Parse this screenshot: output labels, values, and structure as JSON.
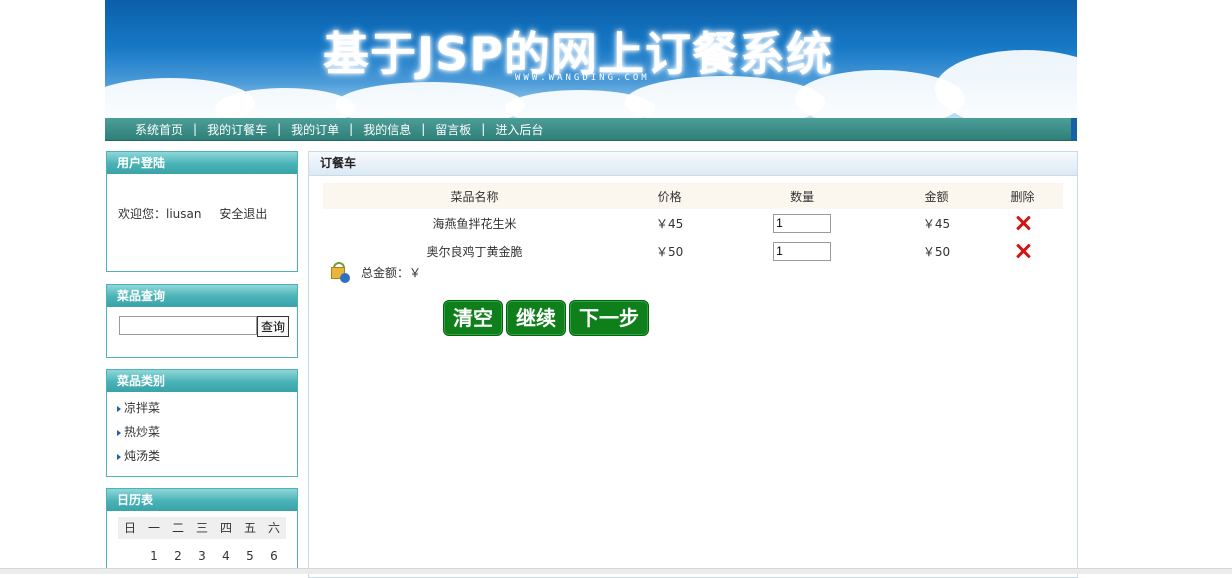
{
  "banner": {
    "title": "基于JSP的网上订餐系统",
    "subtitle": "WWW.WANGDING.COM"
  },
  "nav": {
    "items": [
      "系统首页",
      "我的订餐车",
      "我的订单",
      "我的信息",
      "留言板",
      "进入后台"
    ],
    "separator": "|"
  },
  "login": {
    "title": "用户登陆",
    "welcome": "欢迎您：liusan",
    "logout": "安全退出"
  },
  "search": {
    "title": "菜品查询",
    "value": "",
    "button": "查询"
  },
  "categories": {
    "title": "菜品类别",
    "items": [
      "凉拌菜",
      "热炒菜",
      "炖汤类"
    ]
  },
  "calendar": {
    "title": "日历表",
    "weekdays": [
      "日",
      "一",
      "二",
      "三",
      "四",
      "五",
      "六"
    ],
    "first_row": [
      "",
      "",
      "1",
      "2",
      "3",
      "4",
      "5",
      "6"
    ]
  },
  "cart": {
    "title": "订餐车",
    "headers": [
      "菜品名称",
      "价格",
      "数量",
      "金额",
      "删除"
    ],
    "rows": [
      {
        "name": "海燕鱼拌花生米",
        "price": "￥45",
        "qty": "1",
        "amount": "￥45"
      },
      {
        "name": "奥尔良鸡丁黄金脆",
        "price": "￥50",
        "qty": "1",
        "amount": "￥50"
      }
    ],
    "total_label": "总金额：￥",
    "buttons": [
      "清空",
      "继续",
      "下一步"
    ]
  },
  "colors": {
    "nav_bg": "#2f7f79",
    "panel_head": "#49b2b6",
    "button_green": "#0f7f1c",
    "delete_red": "#d01515"
  }
}
